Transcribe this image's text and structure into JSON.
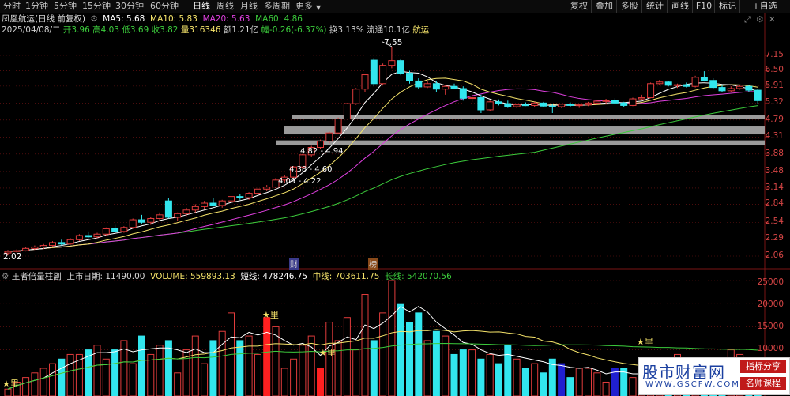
{
  "toolbar": {
    "timeframes": [
      "分时",
      "1分钟",
      "5分钟",
      "15分钟",
      "30分钟",
      "60分钟",
      "日线",
      "周线",
      "月线",
      "多周期",
      "更多"
    ],
    "active_timeframe": "日线",
    "buttons": [
      "复权",
      "叠加",
      "多股",
      "统计",
      "画线",
      "F10",
      "标记",
      "+自选"
    ]
  },
  "header": {
    "stock_name": "凤凰航运(日线 前复权)",
    "ma5_label": "MA5: 5.68",
    "ma10_label": "MA10: 5.83",
    "ma20_label": "MA20: 5.63",
    "ma60_label": "MA60: 4.86",
    "date": "2025/04/08/二",
    "open": "开3.96",
    "high": "高4.03",
    "low": "低3.69",
    "close": "收3.82",
    "volume": "量316346",
    "amount": "额1.21亿",
    "change": "幅-0.26(-6.37%)",
    "turnover": "换3.13%",
    "float_cap": "流通10.1亿",
    "sector": "航运"
  },
  "colors": {
    "up": "#e23c3c",
    "down": "#32e6ee",
    "ma5": "#ffffff",
    "ma10": "#f5e36a",
    "ma20": "#e040e0",
    "ma60": "#3ccc3c",
    "grid": "#7a1515"
  },
  "price_axis": {
    "ticks": [
      "7.15",
      "6.50",
      "5.91",
      "5.32",
      "4.79",
      "4.31",
      "3.88",
      "3.48",
      "3.14",
      "2.84",
      "2.54",
      "2.29",
      "2.06"
    ]
  },
  "annotations": {
    "high_mark": "7.55",
    "low_mark": "2.02",
    "zone1": "4.82 - 4.94",
    "zone2": "4.38 - 4.60",
    "zone3": "4.09 - 4.22",
    "tag_cai": "财",
    "tag_bang": "榜"
  },
  "indicator": {
    "name": "王者倍量柱副",
    "list_date_label": "上市日期: 11490.00",
    "volume_label": "VOLUME: 559893.13",
    "short_label": "短线: 478246.75",
    "mid_label": "中线: 703611.75",
    "long_label": "长线: 542070.56",
    "star_label": "★里",
    "axis": [
      "25000",
      "20000",
      "15000",
      "10000"
    ]
  },
  "watermark": {
    "title": "股市财富网",
    "url": "WWW.GSCFW.COM",
    "tag1": "指标分享",
    "tag2": "名师课程"
  },
  "chart_data": {
    "type": "candlestick",
    "candles": [
      [
        2.1,
        2.14,
        2.08,
        2.12
      ],
      [
        2.12,
        2.15,
        2.1,
        2.13
      ],
      [
        2.13,
        2.18,
        2.12,
        2.16
      ],
      [
        2.16,
        2.2,
        2.14,
        2.18
      ],
      [
        2.18,
        2.22,
        2.15,
        2.2
      ],
      [
        2.2,
        2.26,
        2.18,
        2.24
      ],
      [
        2.24,
        2.28,
        2.2,
        2.22
      ],
      [
        2.22,
        2.3,
        2.21,
        2.28
      ],
      [
        2.28,
        2.36,
        2.26,
        2.34
      ],
      [
        2.34,
        2.4,
        2.3,
        2.32
      ],
      [
        2.32,
        2.38,
        2.3,
        2.36
      ],
      [
        2.36,
        2.46,
        2.34,
        2.44
      ],
      [
        2.44,
        2.5,
        2.38,
        2.4
      ],
      [
        2.4,
        2.48,
        2.38,
        2.46
      ],
      [
        2.46,
        2.6,
        2.44,
        2.58
      ],
      [
        2.58,
        2.66,
        2.52,
        2.54
      ],
      [
        2.54,
        2.62,
        2.5,
        2.6
      ],
      [
        2.6,
        2.7,
        2.56,
        2.66
      ],
      [
        2.9,
        2.95,
        2.6,
        2.62
      ],
      [
        2.62,
        2.7,
        2.56,
        2.68
      ],
      [
        2.68,
        2.78,
        2.64,
        2.74
      ],
      [
        2.74,
        2.84,
        2.7,
        2.8
      ],
      [
        2.8,
        2.9,
        2.76,
        2.86
      ],
      [
        2.86,
        2.96,
        2.8,
        2.82
      ],
      [
        2.82,
        2.92,
        2.78,
        2.9
      ],
      [
        2.9,
        3.02,
        2.86,
        2.98
      ],
      [
        2.98,
        3.02,
        2.92,
        2.96
      ],
      [
        2.96,
        3.06,
        2.92,
        3.04
      ],
      [
        3.04,
        3.16,
        3.0,
        3.12
      ],
      [
        3.12,
        3.2,
        3.08,
        3.16
      ],
      [
        3.16,
        3.34,
        3.14,
        3.3
      ],
      [
        3.3,
        3.4,
        3.24,
        3.36
      ],
      [
        3.36,
        3.6,
        3.34,
        3.58
      ],
      [
        3.58,
        3.88,
        3.54,
        3.86
      ],
      [
        3.86,
        4.08,
        3.82,
        4.04
      ],
      [
        4.04,
        4.24,
        4.0,
        4.2
      ],
      [
        4.2,
        4.46,
        4.14,
        4.42
      ],
      [
        4.42,
        4.86,
        4.4,
        4.82
      ],
      [
        4.82,
        5.32,
        4.8,
        5.3
      ],
      [
        5.3,
        5.84,
        5.26,
        5.8
      ],
      [
        5.8,
        6.38,
        5.7,
        6.34
      ],
      [
        6.94,
        7.0,
        5.9,
        6.0
      ],
      [
        6.0,
        6.8,
        5.96,
        6.72
      ],
      [
        6.72,
        7.55,
        6.6,
        6.92
      ],
      [
        6.92,
        6.98,
        6.32,
        6.4
      ],
      [
        6.4,
        6.5,
        6.0,
        6.1
      ],
      [
        6.1,
        6.2,
        5.8,
        5.88
      ],
      [
        5.88,
        6.1,
        5.84,
        6.0
      ],
      [
        6.0,
        6.1,
        5.7,
        5.8
      ],
      [
        5.8,
        5.94,
        5.6,
        5.9
      ],
      [
        5.9,
        6.0,
        5.8,
        5.82
      ],
      [
        5.82,
        5.9,
        5.4,
        5.48
      ],
      [
        5.48,
        5.6,
        5.36,
        5.5
      ],
      [
        5.5,
        5.6,
        5.0,
        5.1
      ],
      [
        5.1,
        5.4,
        5.06,
        5.36
      ],
      [
        5.36,
        5.44,
        5.24,
        5.3
      ],
      [
        5.3,
        5.4,
        5.16,
        5.2
      ],
      [
        5.2,
        5.3,
        5.16,
        5.26
      ],
      [
        5.26,
        5.34,
        5.22,
        5.24
      ],
      [
        5.24,
        5.36,
        5.2,
        5.32
      ],
      [
        5.32,
        5.36,
        5.2,
        5.22
      ],
      [
        5.22,
        5.28,
        5.0,
        5.2
      ],
      [
        5.2,
        5.3,
        5.16,
        5.28
      ],
      [
        5.28,
        5.34,
        5.2,
        5.24
      ],
      [
        5.24,
        5.3,
        5.16,
        5.26
      ],
      [
        5.26,
        5.36,
        5.22,
        5.32
      ],
      [
        5.32,
        5.42,
        5.28,
        5.38
      ],
      [
        5.38,
        5.46,
        5.3,
        5.4
      ],
      [
        5.4,
        5.48,
        5.3,
        5.32
      ],
      [
        5.32,
        5.36,
        5.2,
        5.24
      ],
      [
        5.24,
        5.5,
        5.22,
        5.46
      ],
      [
        5.46,
        5.6,
        5.42,
        5.5
      ],
      [
        5.5,
        6.04,
        5.48,
        6.0
      ],
      [
        6.0,
        6.14,
        5.94,
        6.06
      ],
      [
        6.06,
        6.1,
        5.9,
        5.94
      ],
      [
        5.94,
        6.0,
        5.84,
        5.96
      ],
      [
        5.96,
        6.04,
        5.86,
        5.9
      ],
      [
        5.9,
        6.3,
        5.86,
        6.24
      ],
      [
        6.24,
        6.48,
        6.08,
        6.12
      ],
      [
        6.12,
        6.2,
        5.8,
        5.86
      ],
      [
        5.86,
        5.96,
        5.68,
        5.74
      ],
      [
        5.74,
        5.9,
        5.7,
        5.82
      ],
      [
        5.82,
        5.96,
        5.78,
        5.9
      ],
      [
        5.9,
        5.96,
        5.7,
        5.76
      ],
      [
        5.76,
        5.8,
        5.3,
        5.4
      ]
    ],
    "volumes": [
      1.5,
      3,
      4,
      5,
      6,
      7,
      8,
      9,
      9,
      10,
      11,
      8,
      10,
      12,
      7,
      13,
      9,
      11,
      12,
      5,
      10,
      13,
      7,
      12,
      14,
      18,
      12,
      13,
      9,
      17,
      15,
      6,
      8,
      11,
      13,
      6,
      16,
      12,
      17,
      10,
      22,
      12,
      18,
      25,
      20,
      16,
      18,
      12,
      14,
      13,
      9,
      10,
      10,
      8,
      9,
      7,
      11,
      8,
      6,
      7,
      5,
      8,
      7,
      4,
      6,
      6,
      5,
      3,
      6,
      6,
      4,
      5,
      8,
      7,
      6,
      9,
      7,
      5,
      8,
      4,
      6,
      10,
      9,
      8,
      6
    ]
  }
}
